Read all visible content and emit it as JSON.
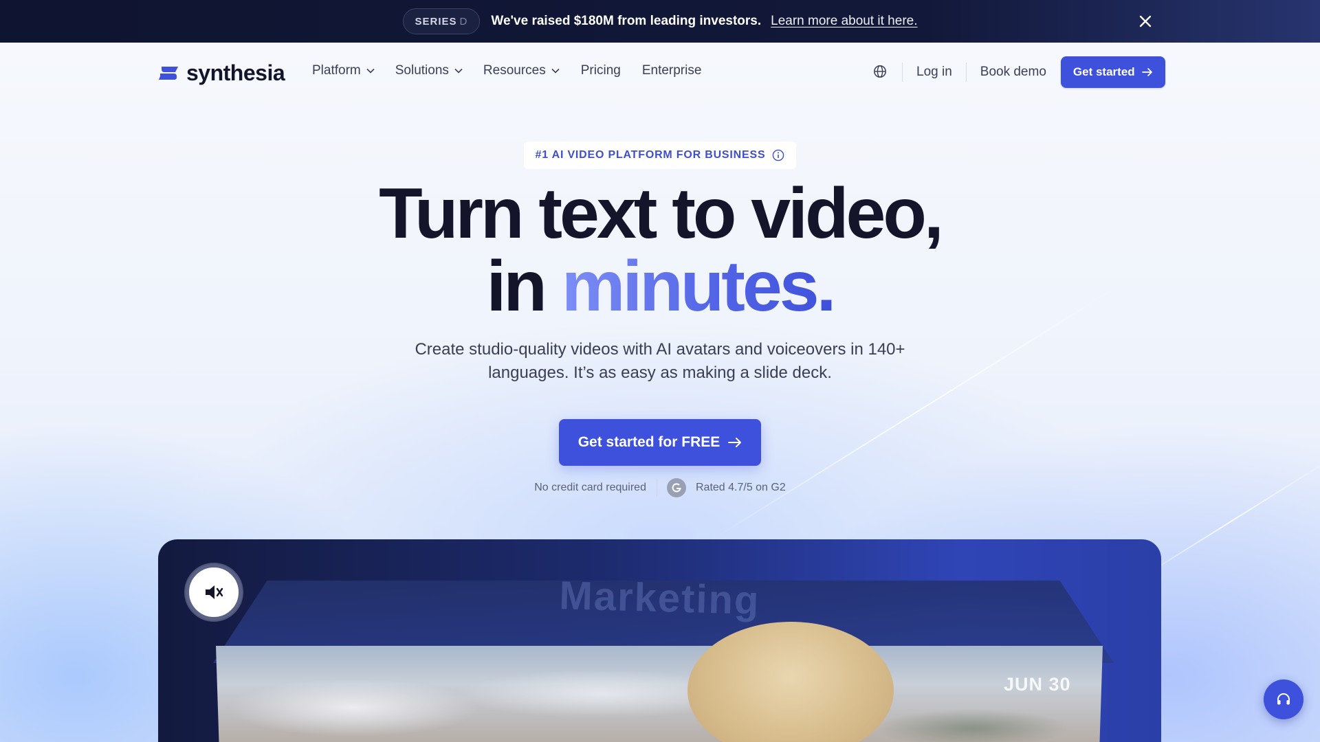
{
  "announcement": {
    "pill_main": "SERIES",
    "pill_letter": "D",
    "message": "We've raised $180M from leading investors.",
    "link": "Learn more about it here."
  },
  "nav": {
    "brand": "synthesia",
    "items": [
      {
        "label": "Platform",
        "has_dropdown": true
      },
      {
        "label": "Solutions",
        "has_dropdown": true
      },
      {
        "label": "Resources",
        "has_dropdown": true
      },
      {
        "label": "Pricing",
        "has_dropdown": false
      },
      {
        "label": "Enterprise",
        "has_dropdown": false
      }
    ],
    "login": "Log in",
    "book_demo": "Book demo",
    "get_started": "Get started"
  },
  "hero": {
    "badge": "#1 AI VIDEO PLATFORM FOR BUSINESS",
    "headline_line1": "Turn text to video,",
    "headline_in": "in ",
    "headline_accent": "minutes.",
    "subhead": "Create studio-quality videos with AI avatars and voiceovers in 140+ languages. It’s as easy as making a slide deck.",
    "cta": "Get started for FREE",
    "no_card": "No credit card required",
    "rating": "Rated 4.7/5 on G2"
  },
  "video": {
    "ghost_title": "Marketing",
    "date_label": "JUN 30"
  },
  "colors": {
    "primary": "#3d51dd",
    "announcement_bg": "#121839",
    "heading": "#14152b"
  },
  "icons": {
    "close": "close-icon",
    "chevron": "chevron-down-icon",
    "globe": "globe-icon",
    "arrow": "arrow-right-icon",
    "info": "info-icon",
    "g2": "g2-logo-icon",
    "mute": "speaker-muted-icon",
    "support": "headset-icon"
  }
}
